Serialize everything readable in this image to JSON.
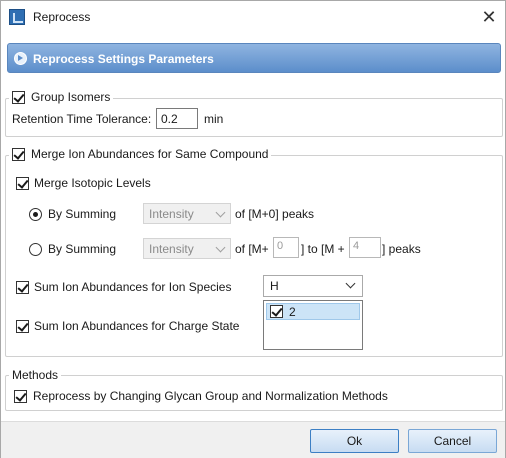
{
  "window": {
    "title": "Reprocess",
    "close_glyph": "✕"
  },
  "header": {
    "title": "Reprocess Settings Parameters"
  },
  "group_isomers": {
    "label": "Group Isomers",
    "checked": true,
    "rt_label": "Retention Time Tolerance:",
    "rt_value": "0.2",
    "rt_unit": "min"
  },
  "merge_ion": {
    "label": "Merge Ion Abundances for Same Compound",
    "checked": true,
    "isotopic": {
      "label": "Merge Isotopic Levels",
      "checked": true
    },
    "option1": {
      "label": "By Summing",
      "selected": true,
      "combo": "Intensity",
      "suffix": "of [M+0] peaks"
    },
    "option2": {
      "label": "By Summing",
      "selected": false,
      "combo": "Intensity",
      "prefix": "of [M+",
      "from": "0",
      "mid": "] to [M +",
      "to": "4",
      "suffix": "] peaks"
    },
    "ion_species": {
      "label": "Sum Ion Abundances for Ion Species",
      "checked": true,
      "value": "H"
    },
    "charge_state": {
      "label": "Sum Ion Abundances for Charge State",
      "checked": true,
      "items": [
        {
          "label": "2",
          "checked": true
        }
      ]
    }
  },
  "methods": {
    "group_label": "Methods",
    "reprocess": {
      "label": "Reprocess by Changing Glycan Group and Normalization Methods",
      "checked": true
    }
  },
  "buttons": {
    "ok": "Ok",
    "cancel": "Cancel"
  }
}
